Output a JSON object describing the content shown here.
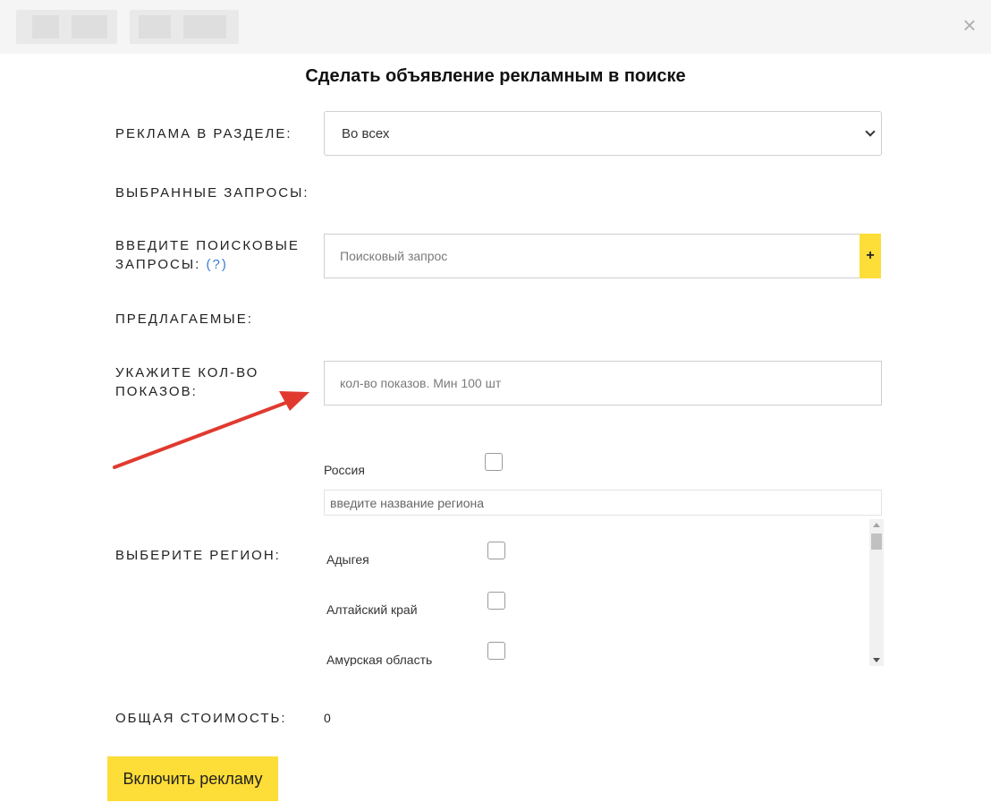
{
  "header": {
    "close_icon": "close-icon"
  },
  "dialog": {
    "title": "Сделать объявление рекламным в поиске",
    "section": {
      "label": "РЕКЛАМА В РАЗДЕЛЕ:",
      "selected": "Во всех"
    },
    "selected_queries": {
      "label": "ВЫБРАННЫЕ ЗАПРОСЫ:"
    },
    "search_queries": {
      "label_line1": "ВВЕДИТЕ ПОИСКОВЫЕ",
      "label_line2": "ЗАПРОСЫ:",
      "help": "(?)",
      "placeholder": "Поисковый запрос",
      "add_label": "+"
    },
    "suggested": {
      "label": "ПРЕДЛАГАЕМЫЕ:"
    },
    "views": {
      "label_line1": "УКАЖИТЕ КОЛ-ВО",
      "label_line2": "ПОКАЗОВ:",
      "placeholder": "кол-во показов. Мин 100 шт"
    },
    "region": {
      "label": "ВЫБЕРИТЕ РЕГИОН:",
      "country": "Россия",
      "search_placeholder": "введите название региона",
      "items": [
        {
          "name": "Адыгея"
        },
        {
          "name": "Алтайский край"
        },
        {
          "name": "Амурская область"
        }
      ]
    },
    "total": {
      "label": "ОБЩАЯ СТОИМОСТЬ:",
      "value": "0"
    },
    "enable_button": "Включить рекламу"
  },
  "colors": {
    "accent": "#fddd37",
    "arrow": "#e03a2f",
    "link": "#3a7bd5"
  }
}
